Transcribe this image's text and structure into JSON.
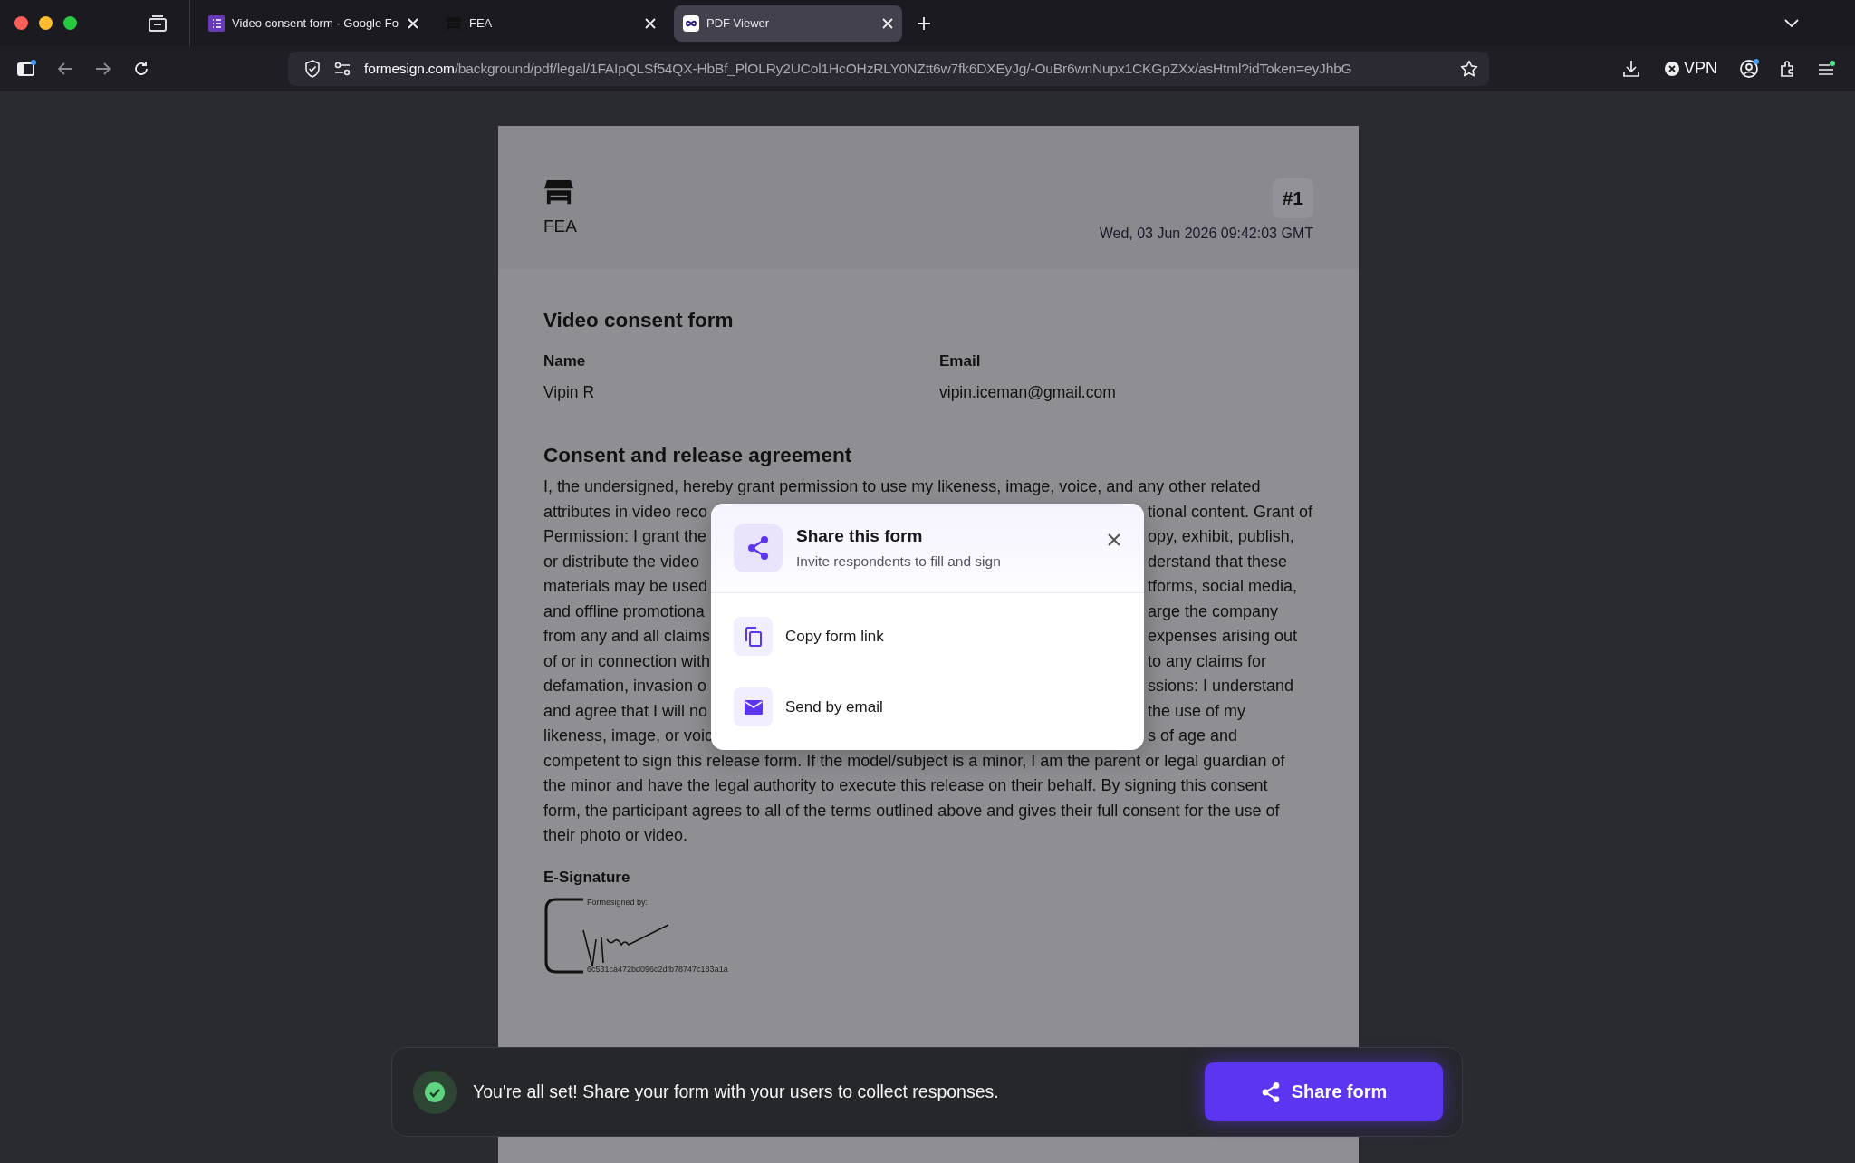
{
  "browser": {
    "tabs": [
      {
        "kind": "forms",
        "title": "Video consent form - Google Fo",
        "selected": false
      },
      {
        "kind": "store",
        "title": "FEA",
        "selected": false
      },
      {
        "kind": "pdf",
        "title": "PDF Viewer",
        "selected": true
      }
    ],
    "address": {
      "domain": "formesign.com",
      "path": "/background/pdf/legal/1FAIpQLSf54QX-HbBf_PlOLRy2UCol1HcOHzRLY0NZtt6w7fk6DXEyJg/-OuBr6wnNupx1CKGpZXx/asHtml?idToken=eyJhbG"
    },
    "vpn": "VPN"
  },
  "document": {
    "org": "FEA",
    "number": "#1",
    "timestamp": "Wed, 03 Jun 2026 09:42:03 GMT",
    "title": "Video consent form",
    "fields": [
      {
        "label": "Name",
        "value": "Vipin R"
      },
      {
        "label": "Email",
        "value": "vipin.iceman@gmail.com"
      }
    ],
    "section": "Consent and release agreement",
    "lines": [
      {
        "parts": [
          "I, the undersigned, hereby grant permission to use my likeness, image, voice, and any other related"
        ]
      },
      {
        "parts": [
          "attributes in video reco",
          "tional content. Grant of"
        ]
      },
      {
        "parts": [
          "Permission: I grant the",
          "opy, exhibit, publish,"
        ]
      },
      {
        "parts": [
          "or distribute the video",
          "derstand that these"
        ]
      },
      {
        "parts": [
          "materials may be used",
          "tforms, social media,"
        ]
      },
      {
        "parts": [
          "and offline promotiona",
          "arge the company"
        ]
      },
      {
        "parts": [
          "from any and all claims",
          "expenses arising out"
        ]
      },
      {
        "parts": [
          "of or in connection with",
          "to any claims for"
        ]
      },
      {
        "parts": [
          "defamation, invasion o",
          "ssions: I understand"
        ]
      },
      {
        "parts": [
          "and agree that I will no",
          "the use of my"
        ]
      },
      {
        "parts": [
          "likeness, image, or voic",
          "s of age and"
        ]
      },
      {
        "parts": [
          "competent to sign this release form. If the model/subject is a minor, I am the parent or legal guardian of"
        ]
      },
      {
        "parts": [
          "the minor and have the legal authority to execute this release on their behalf. By signing this consent"
        ]
      },
      {
        "parts": [
          "form, the participant agrees to all of the terms outlined above and gives their full consent for the use of"
        ]
      },
      {
        "parts": [
          "their photo or video."
        ]
      }
    ],
    "signature": {
      "heading": "E-Signature",
      "caption": "Formesigned by:",
      "hash": "6c531ca472bd096c2dfb78747c183a1a"
    }
  },
  "modal": {
    "title": "Share this form",
    "subtitle": "Invite respondents to fill and sign",
    "options": [
      {
        "kind": "copy",
        "label": "Copy form link"
      },
      {
        "kind": "email",
        "label": "Send by email"
      }
    ]
  },
  "toast": {
    "message": "You're all set! Share your form with your users to collect responses.",
    "button": "Share form"
  }
}
